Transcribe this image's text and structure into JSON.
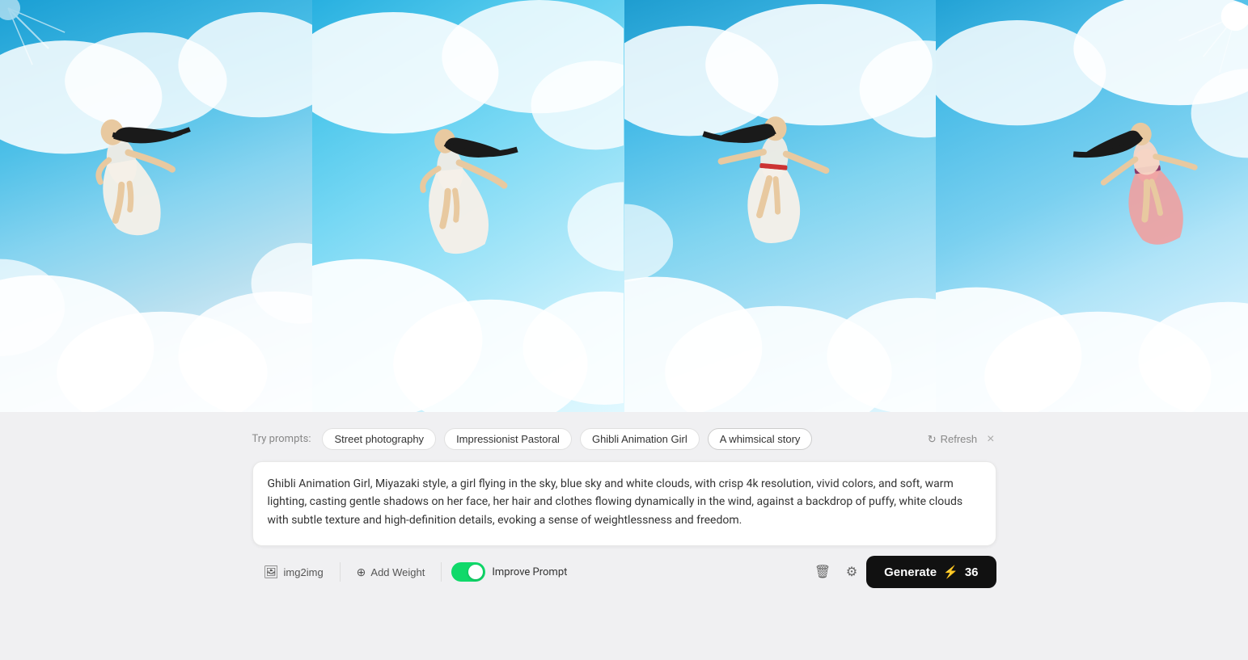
{
  "gallery": {
    "panels": [
      {
        "id": "panel-1",
        "alt": "Girl flying in sky - pose 1"
      },
      {
        "id": "panel-2",
        "alt": "Girl flying in sky - pose 2"
      },
      {
        "id": "panel-3",
        "alt": "Girl flying in sky - pose 3"
      },
      {
        "id": "panel-4",
        "alt": "Girl flying in sky - pose 4"
      }
    ]
  },
  "prompts_bar": {
    "label": "Try prompts:",
    "chips": [
      {
        "id": "street",
        "label": "Street photography"
      },
      {
        "id": "impressionist",
        "label": "Impressionist Pastoral"
      },
      {
        "id": "ghibli",
        "label": "Ghibli Animation Girl"
      },
      {
        "id": "whimsical",
        "label": "A whimsical story"
      }
    ],
    "refresh_label": "Refresh",
    "close_label": "×"
  },
  "prompt_text": "Ghibli Animation Girl, Miyazaki style, a girl flying in the sky, blue sky and white clouds, with crisp 4k resolution, vivid colors, and soft, warm lighting, casting gentle shadows on her face, her hair and clothes flowing dynamically in the wind, against a backdrop of puffy, white clouds with subtle texture and high-definition details, evoking a sense of weightlessness and freedom.",
  "toolbar": {
    "img2img_label": "img2img",
    "add_weight_label": "Add Weight",
    "improve_prompt_label": "Improve Prompt",
    "toggle_on": true
  },
  "generate_button": {
    "label": "Generate",
    "cost": "36",
    "lightning": "⚡"
  }
}
